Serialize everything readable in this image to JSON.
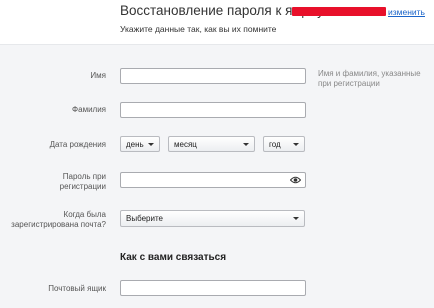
{
  "header": {
    "title": "Восстановление пароля к ящику",
    "change_link": "изменить",
    "subtitle": "Укажите данные так, как вы их помните"
  },
  "form": {
    "first_name": {
      "label": "Имя",
      "value": "",
      "hint": "Имя и фамилия, указанные при регистрации"
    },
    "last_name": {
      "label": "Фамилия",
      "value": ""
    },
    "birth_date": {
      "label": "Дата рождения",
      "day": "день",
      "month": "месяц",
      "year": "год"
    },
    "password": {
      "label": "Пароль при регистрации",
      "value": ""
    },
    "registered_when": {
      "label": "Когда была зарегистрирована почта?",
      "selected": "Выберите"
    },
    "contact_heading": "Как с вами связаться",
    "mailbox": {
      "label": "Почтовый ящик",
      "value": ""
    }
  },
  "colors": {
    "link": "#1a64c9",
    "redaction": "#e8102a",
    "background": "#f4f5f7"
  },
  "icons": {
    "password_toggle": "eye-icon"
  }
}
